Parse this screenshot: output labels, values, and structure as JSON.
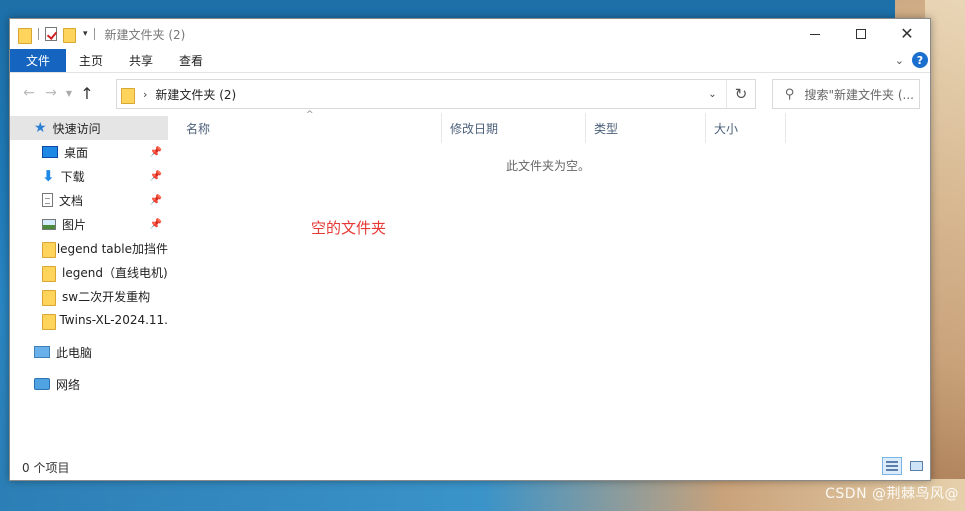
{
  "window": {
    "title": "新建文件夹 (2)"
  },
  "ribbon": {
    "tabs": [
      "文件",
      "主页",
      "共享",
      "查看"
    ]
  },
  "address": {
    "crumb": "新建文件夹 (2)",
    "search_placeholder": "搜索\"新建文件夹 (..."
  },
  "sidebar": {
    "quick_access": "快速访问",
    "pinned": [
      "桌面",
      "下载",
      "文档",
      "图片"
    ],
    "recent": [
      "legend table加挡件",
      "legend（直线电机)",
      "sw二次开发重构",
      "Twins-XL-2024.11."
    ],
    "this_pc": "此电脑",
    "network": "网络"
  },
  "columns": [
    "名称",
    "修改日期",
    "类型",
    "大小"
  ],
  "content": {
    "empty_message": "此文件夹为空。",
    "annotation": "空的文件夹"
  },
  "status": {
    "item_count": "0 个项目"
  },
  "watermark": "CSDN @荆棘鸟风@",
  "colors": {
    "accent": "#1565c0",
    "annotation": "#e53935",
    "folder": "#ffd45c"
  }
}
